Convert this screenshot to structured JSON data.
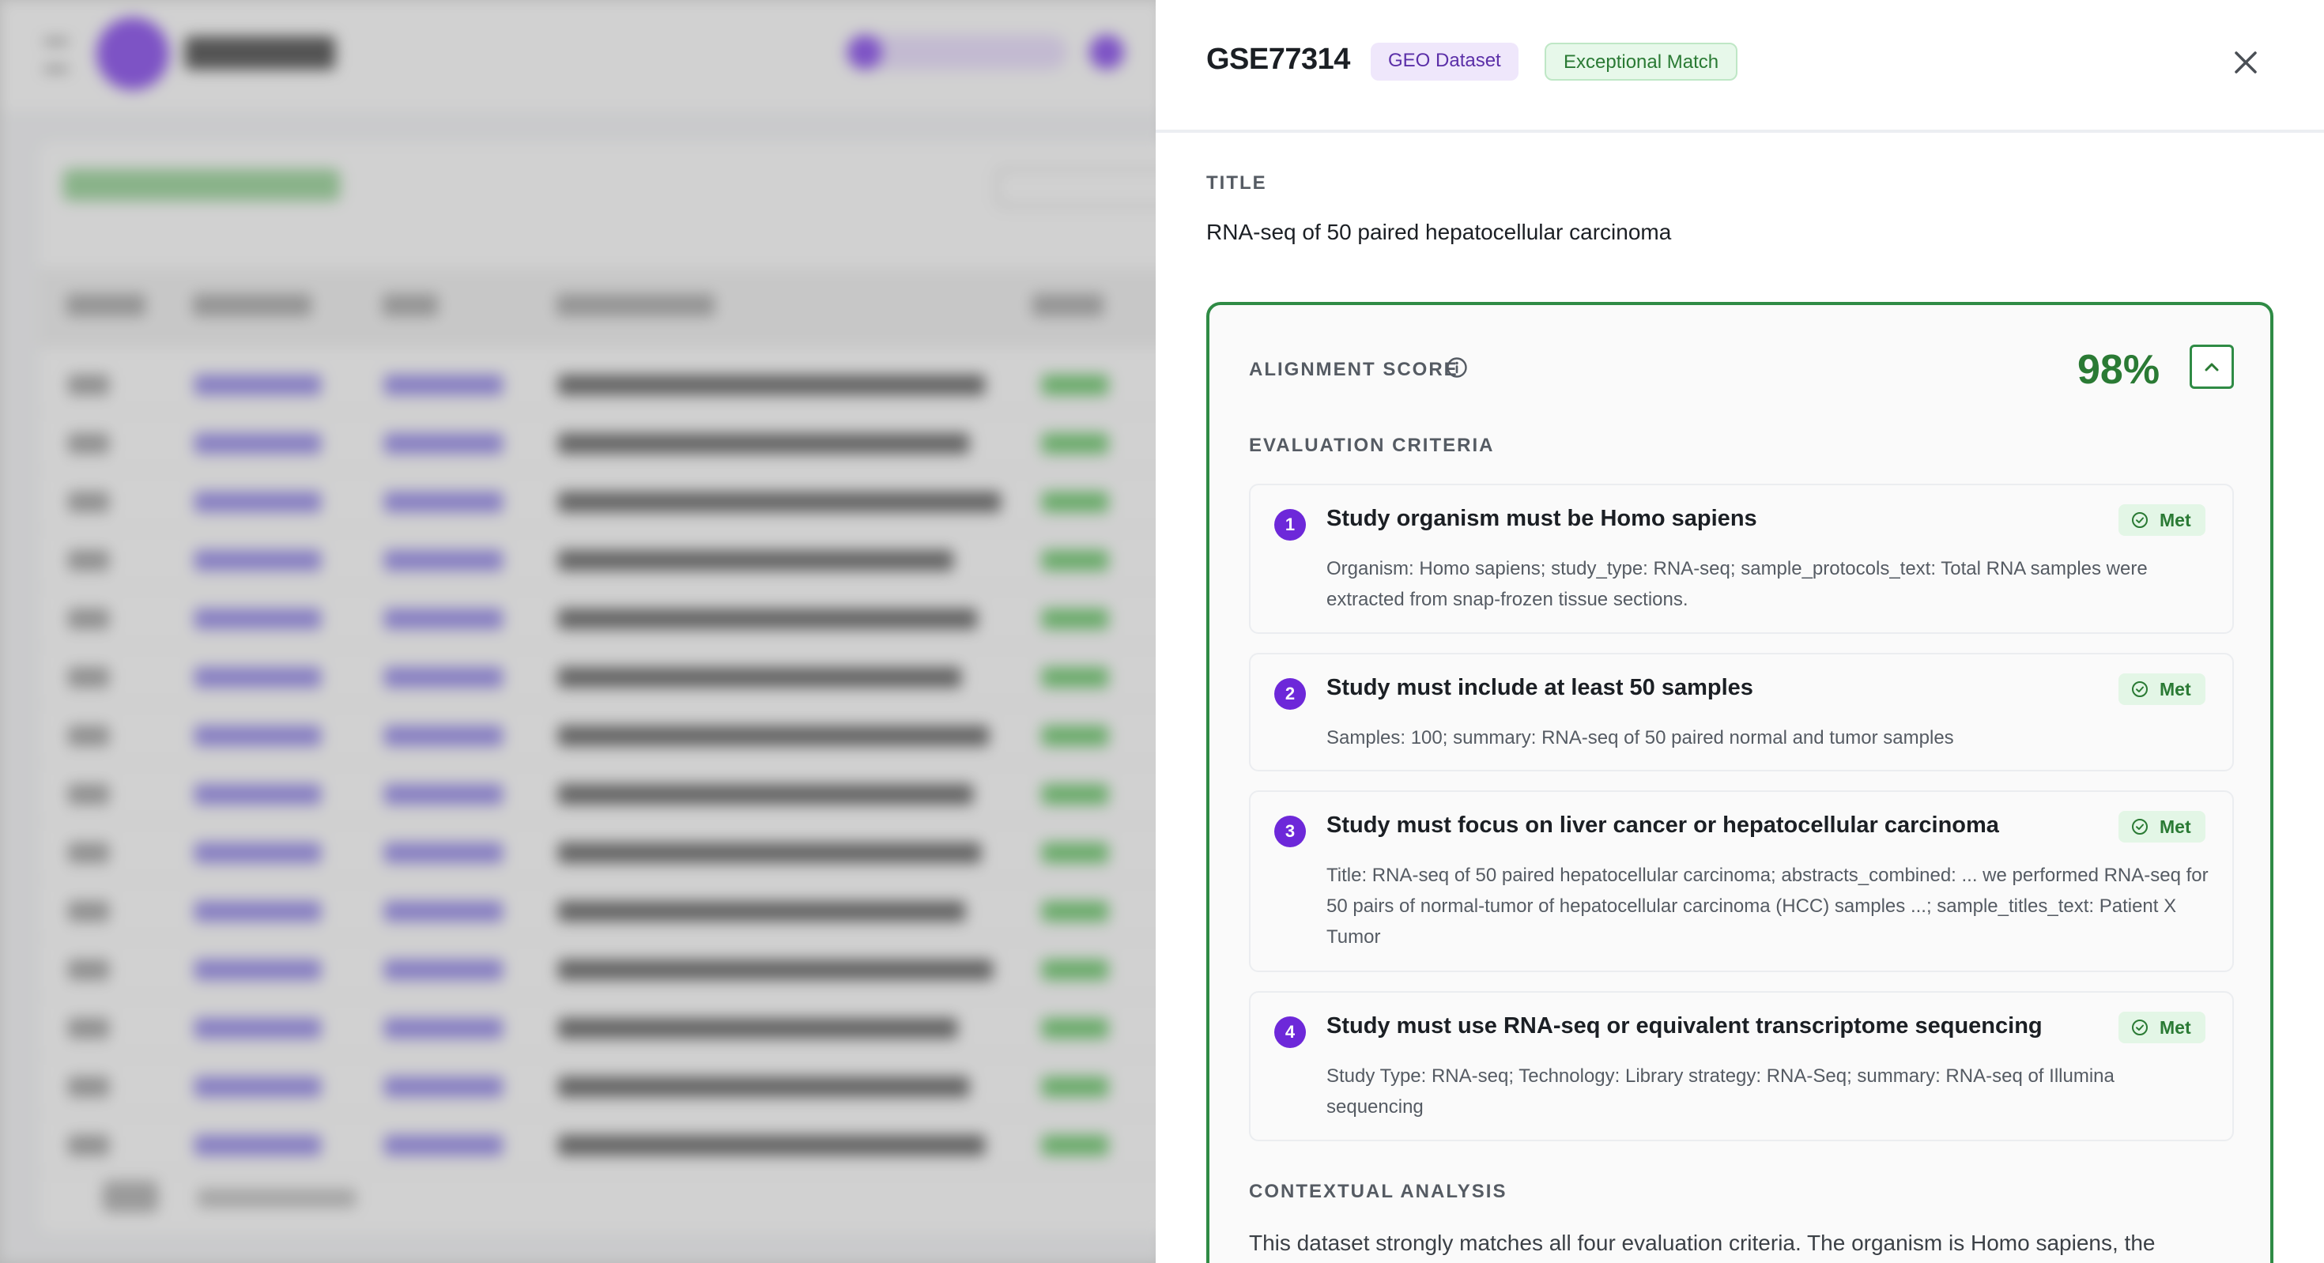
{
  "dataset": {
    "id": "GSE77314",
    "type_badge": "GEO Dataset",
    "match_badge": "Exceptional Match"
  },
  "title_section": {
    "label": "TITLE",
    "text": "RNA-seq of 50 paired hepatocellular carcinoma"
  },
  "alignment": {
    "label": "ALIGNMENT SCORE",
    "score": "98%",
    "criteria_label": "EVALUATION CRITERIA",
    "criteria": [
      {
        "number": "1",
        "title": "Study organism must be Homo sapiens",
        "status": "Met",
        "description": "Organism: Homo sapiens; study_type: RNA-seq; sample_protocols_text: Total RNA samples were extracted from snap-frozen tissue sections."
      },
      {
        "number": "2",
        "title": "Study must include at least 50 samples",
        "status": "Met",
        "description": "Samples: 100; summary: RNA-seq of 50 paired normal and tumor samples"
      },
      {
        "number": "3",
        "title": "Study must focus on liver cancer or hepatocellular carcinoma",
        "status": "Met",
        "description": "Title: RNA-seq of 50 paired hepatocellular carcinoma; abstracts_combined: ... we performed RNA-seq for 50 pairs of normal-tumor of hepatocellular carcinoma (HCC) samples ...; sample_titles_text: Patient X Tumor"
      },
      {
        "number": "4",
        "title": "Study must use RNA-seq or equivalent transcriptome sequencing",
        "status": "Met",
        "description": "Study Type: RNA-seq; Technology: Library strategy: RNA-Seq; summary: RNA-seq of Illumina sequencing"
      }
    ],
    "contextual_label": "CONTEXTUAL ANALYSIS",
    "contextual_text": "This dataset strongly matches all four evaluation criteria. The organism is Homo sapiens, the"
  },
  "icons": {
    "close": "close-icon",
    "info": "info-icon",
    "collapse": "chevron-up-icon",
    "met": "check-circle-icon"
  },
  "colors": {
    "accent_purple": "#6d28d9",
    "match_green": "#2a7a34",
    "border_green": "#2f8b45"
  }
}
